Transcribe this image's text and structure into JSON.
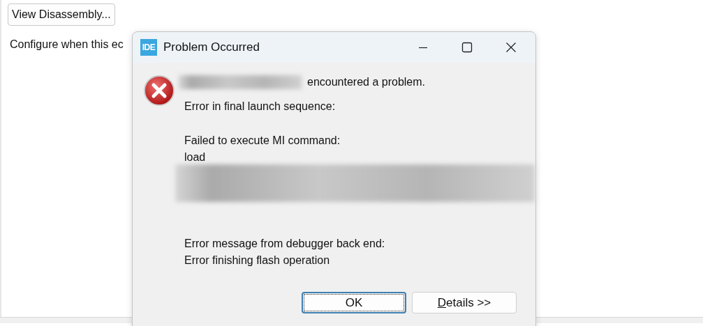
{
  "background": {
    "button": "View Disassembly...",
    "text": "Configure when this ec"
  },
  "dialog": {
    "title": "Problem Occurred",
    "app_icon": "IDE",
    "heading": {
      "redacted_prefix": true,
      "text": "encountered a problem."
    },
    "paragraphs": [
      {
        "lines": [
          "Error in final launch sequence:"
        ],
        "redacted_after": false
      },
      {
        "lines": [
          "Failed to execute MI command:",
          "load"
        ],
        "redacted_after": true
      },
      {
        "lines": [
          "Error message from debugger back end:",
          "Error finishing flash operation"
        ],
        "redacted_after": false
      }
    ],
    "buttons": [
      {
        "label": "OK",
        "focused": true,
        "underline_first": false
      },
      {
        "label": "Details >>",
        "focused": false,
        "underline_first": true
      }
    ]
  }
}
